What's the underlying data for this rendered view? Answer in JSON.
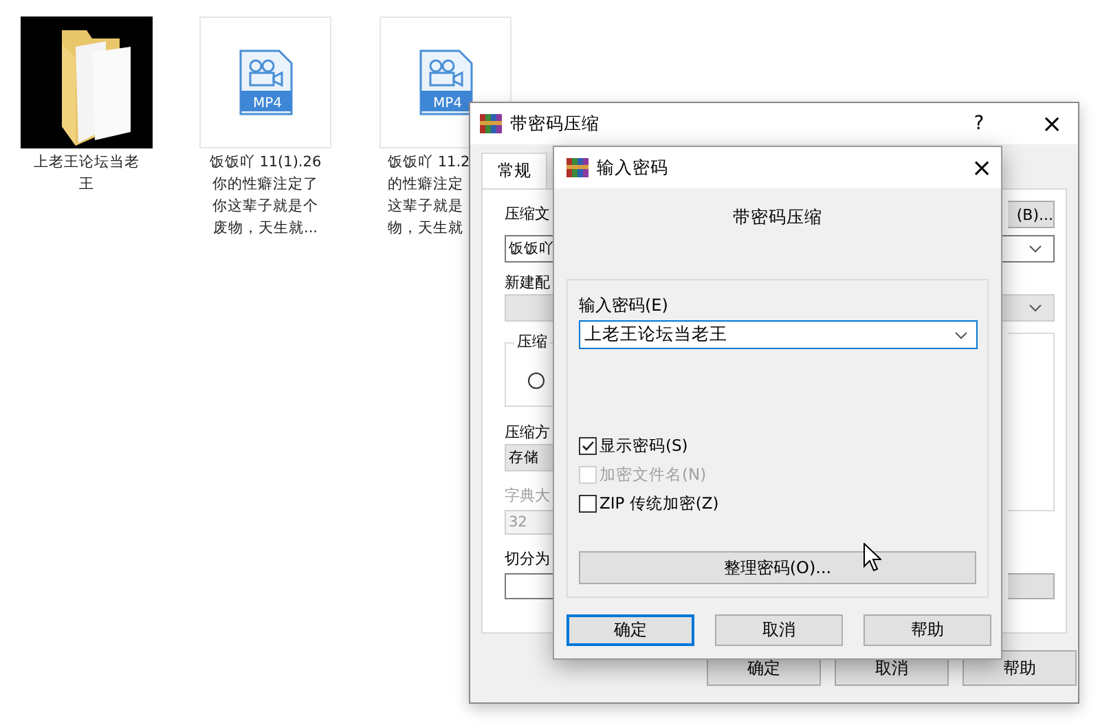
{
  "desktop_icons": [
    {
      "kind": "folder",
      "lines": [
        "上老王论坛当老",
        "王"
      ]
    },
    {
      "kind": "video",
      "badge": "MP4",
      "lines": [
        "饭饭吖 11(1).26",
        "你的性癖注定了",
        "你这辈子就是个",
        "废物，天生就..."
      ]
    },
    {
      "kind": "video",
      "badge": "MP4",
      "lines": [
        "饭饭吖 11.2",
        "的性癖注定",
        "这辈子就是",
        "物，天生就"
      ]
    }
  ],
  "compress_dialog": {
    "title": "带密码压缩",
    "help": "?",
    "close": "×",
    "tabs": [
      {
        "label": "常规",
        "selected": true
      }
    ],
    "archive_label": "压缩文",
    "browse_button": "(B)...",
    "archive_name": "饭饭吖",
    "profile_label": "新建配",
    "group_label": "压缩",
    "group_radio": {
      "selected": false
    },
    "method_label": "压缩方",
    "method_value": "存储",
    "dict_label": "字典大",
    "dict_value": "32",
    "dict_disabled": true,
    "split_label": "切分为",
    "buttons": [
      {
        "label": "确定",
        "default": false
      },
      {
        "label": "取消",
        "default": false
      },
      {
        "label": "帮助",
        "default": false
      }
    ]
  },
  "password_dialog": {
    "title": "输入密码",
    "close": "×",
    "heading": "带密码压缩",
    "password_label": "输入密码(E)",
    "password_value": "上老王论坛当老王",
    "checkboxes": [
      {
        "label": "显示密码(S)",
        "checked": true,
        "disabled": false
      },
      {
        "label": "加密文件名(N)",
        "checked": false,
        "disabled": true
      },
      {
        "label": "ZIP 传统加密(Z)",
        "checked": false,
        "disabled": false
      }
    ],
    "organize_button": "整理密码(O)...",
    "buttons": [
      {
        "label": "确定",
        "default": true
      },
      {
        "label": "取消",
        "default": false
      },
      {
        "label": "帮助",
        "default": false
      }
    ]
  }
}
